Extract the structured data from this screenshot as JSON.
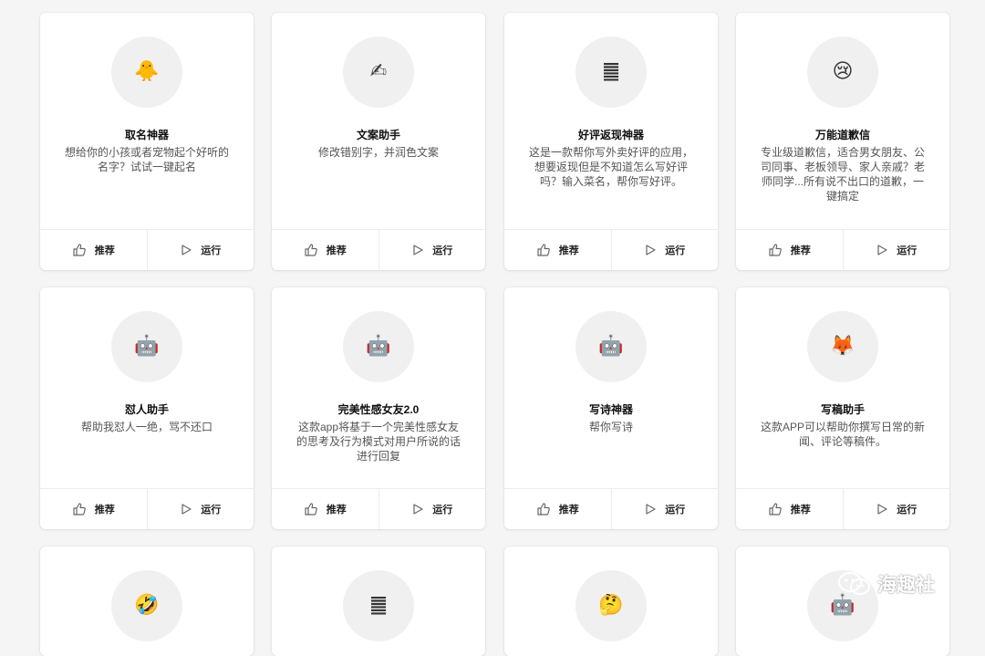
{
  "cards": [
    {
      "icon": "🐥",
      "icon_name": "chick-icon",
      "title": "取名神器",
      "description": "想给你的小孩或者宠物起个好听的名字？试试一键起名",
      "recommend_label": "推荐",
      "run_label": "运行"
    },
    {
      "icon": "✍",
      "icon_name": "writing-hand-icon",
      "title": "文案助手",
      "description": "修改错别字，并润色文案",
      "recommend_label": "推荐",
      "run_label": "运行"
    },
    {
      "icon": "䷀",
      "icon_name": "stacked-lines-icon",
      "title": "好评返现神器",
      "description": "这是一款帮你写外卖好评的应用，想要返现但是不知道怎么写好评吗？输入菜名，帮你写好评。",
      "recommend_label": "推荐",
      "run_label": "运行"
    },
    {
      "icon": "😢",
      "icon_name": "crying-face-icon",
      "title": "万能道歉信",
      "description": "专业级道歉信，适合男女朋友、公司同事、老板领导、家人亲戚？老师同学...所有说不出口的道歉，一键搞定",
      "recommend_label": "推荐",
      "run_label": "运行"
    },
    {
      "icon": "🤖",
      "icon_name": "robot-icon",
      "title": "怼人助手",
      "description": "帮助我怼人一绝，骂不还口",
      "recommend_label": "推荐",
      "run_label": "运行"
    },
    {
      "icon": "🤖",
      "icon_name": "robot-icon",
      "title": "完美性感女友2.0",
      "description": "这款app将基于一个完美性感女友的思考及行为模式对用户所说的话进行回复",
      "recommend_label": "推荐",
      "run_label": "运行"
    },
    {
      "icon": "🤖",
      "icon_name": "robot-icon",
      "title": "写诗神器",
      "description": "帮你写诗",
      "recommend_label": "推荐",
      "run_label": "运行"
    },
    {
      "icon": "🦊",
      "icon_name": "fox-icon",
      "title": "写稿助手",
      "description": "这款APP可以帮助你撰写日常的新闻、评论等稿件。",
      "recommend_label": "推荐",
      "run_label": "运行"
    },
    {
      "icon": "🤣",
      "icon_name": "rolling-laughing-icon",
      "title": "",
      "description": "",
      "recommend_label": "",
      "run_label": ""
    },
    {
      "icon": "䷀",
      "icon_name": "stacked-lines-icon",
      "title": "",
      "description": "",
      "recommend_label": "",
      "run_label": ""
    },
    {
      "icon": "🤔",
      "icon_name": "thinking-face-icon",
      "title": "",
      "description": "",
      "recommend_label": "",
      "run_label": ""
    },
    {
      "icon": "🤖",
      "icon_name": "robot-icon",
      "title": "",
      "description": "",
      "recommend_label": "",
      "run_label": ""
    }
  ],
  "watermark": {
    "text": "海趣社",
    "icon_name": "wechat-icon"
  }
}
